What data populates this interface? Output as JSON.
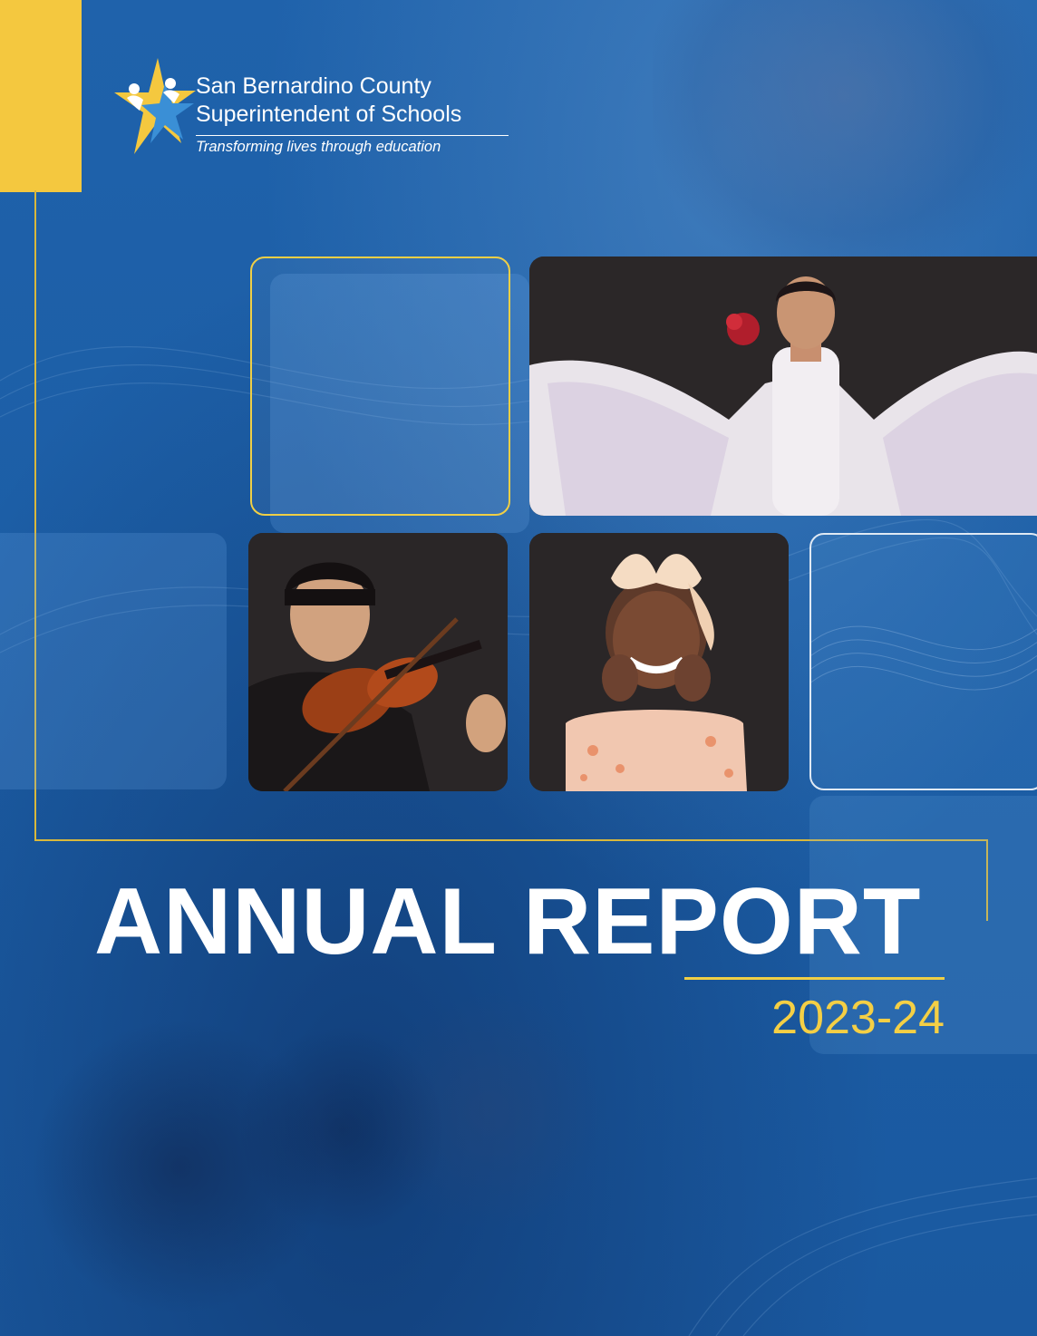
{
  "organization": {
    "name_line1": "San Bernardino County",
    "name_line2": "Superintendent of Schools",
    "tagline": "Transforming lives through education"
  },
  "cover": {
    "title": "ANNUAL REPORT",
    "year": "2023-24"
  },
  "colors": {
    "background_blue": "#1f5fa6",
    "accent_yellow": "#f4c83f",
    "text_white": "#ffffff",
    "logo_star_yellow": "#f4c83f",
    "logo_star_blue": "#3a8fd6"
  },
  "photos": [
    {
      "subject": "folklorico-dancer"
    },
    {
      "subject": "student-violinist"
    },
    {
      "subject": "smiling-girl-with-bow"
    }
  ]
}
